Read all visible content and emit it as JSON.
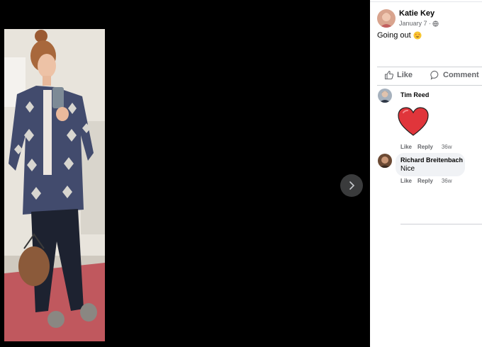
{
  "post": {
    "author": "Katie Key",
    "date": "January 7 ·",
    "text": "Going out",
    "emoji": "heart-eyes-emoji"
  },
  "actions": {
    "like": "Like",
    "comment": "Comment"
  },
  "comments": [
    {
      "author": "Tim Reed",
      "sticker": "heart-sticker",
      "like": "Like",
      "reply": "Reply",
      "time": "36w"
    },
    {
      "author": "Richard Breitenbach",
      "text": "Nice",
      "like": "Like",
      "reply": "Reply",
      "time": "36w"
    }
  ],
  "colors": {
    "panel_bg": "#ffffff",
    "text_primary": "#050505",
    "text_secondary": "#65676b",
    "bubble_bg": "#f0f2f5",
    "heart_red": "#e0353b",
    "viewer_bg": "#000000"
  },
  "icons": [
    "globe-icon",
    "thumbs-up-icon",
    "comment-icon",
    "chevron-right-icon"
  ]
}
